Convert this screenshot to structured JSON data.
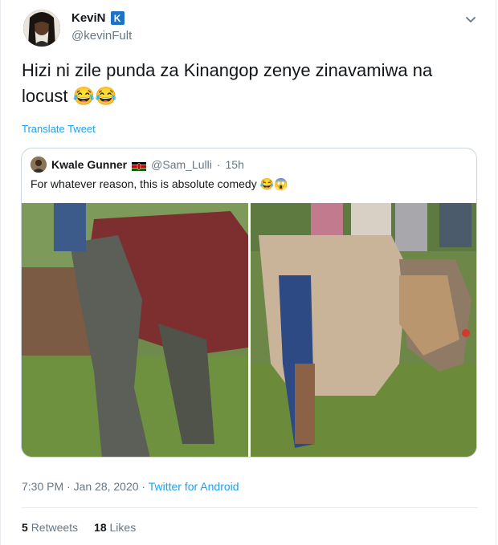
{
  "author": {
    "name": "KeviN",
    "badge": "K",
    "handle": "@kevinFult"
  },
  "tweet": {
    "text": "Hizi ni zile punda za Kinangop zenye zinavamiwa na locust 😂😂",
    "translate_label": "Translate Tweet"
  },
  "quoted": {
    "name": "Kwale Gunner",
    "handle": "@Sam_Lulli",
    "separator": "·",
    "time": "15h",
    "text": "For whatever reason, this is absolute comedy 😂😱"
  },
  "meta": {
    "time": "7:30 PM · Jan 28, 2020 · ",
    "source": "Twitter for Android"
  },
  "stats": {
    "retweets_count": "5",
    "retweets_label": "Retweets",
    "likes_count": "18",
    "likes_label": "Likes"
  },
  "colors": {
    "link": "#1da1f2",
    "muted": "#657786",
    "badge": "#1d73c5"
  },
  "icons": [
    "chevron-down-icon",
    "kenya-flag-icon"
  ]
}
